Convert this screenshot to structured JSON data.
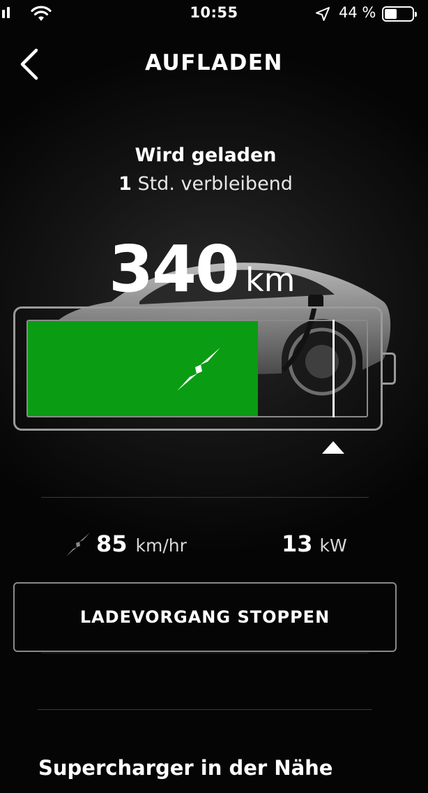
{
  "status_bar": {
    "time": "10:55",
    "battery_percent": "44 %",
    "battery_level": 0.44
  },
  "header": {
    "title": "AUFLADEN",
    "back_icon": "chevron-left-icon"
  },
  "charging": {
    "status": "Wird geladen",
    "remaining_hours": "1",
    "remaining_label": "Std. verbleibend",
    "range_value": "340",
    "range_unit": "km",
    "battery_level": 0.68,
    "charge_limit": 0.9,
    "colors": {
      "charge_fill": "#0a9c12",
      "limit_marker": "#ffffff"
    }
  },
  "stats": {
    "rate_value": "85",
    "rate_unit": "km/hr",
    "power_value": "13",
    "power_unit": "kW"
  },
  "actions": {
    "stop_label": "LADEVORGANG STOPPEN"
  },
  "sections": {
    "supercharger_heading": "Supercharger in der Nähe"
  }
}
